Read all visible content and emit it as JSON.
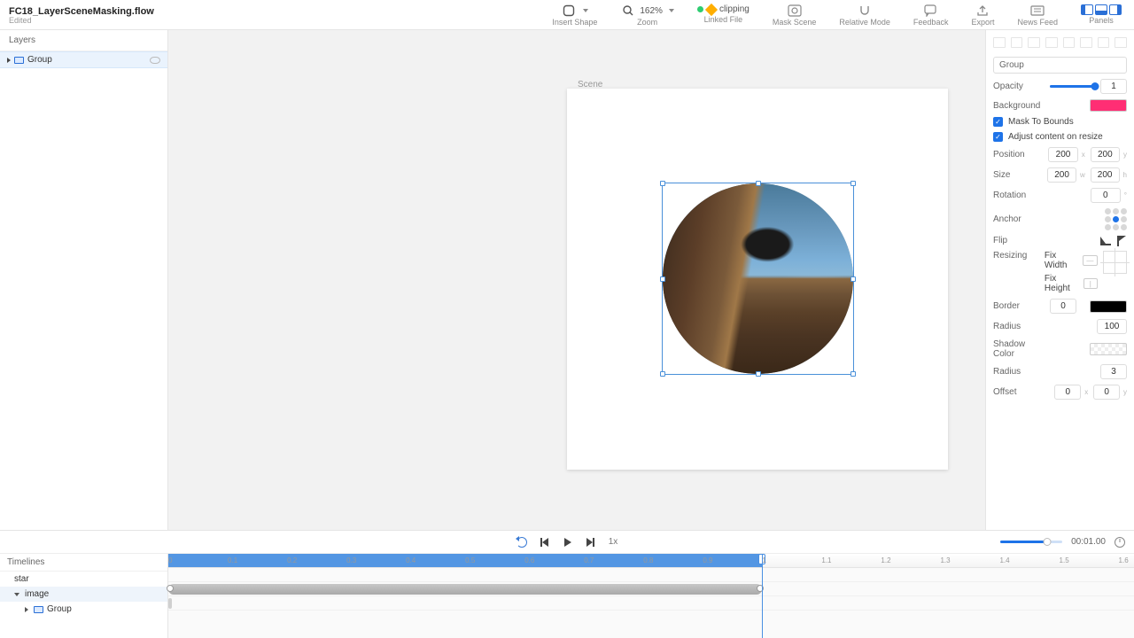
{
  "titlebar": {
    "filename": "FC18_LayerSceneMasking.flow",
    "status": "Edited",
    "insert_shape": "Insert Shape",
    "zoom_label": "Zoom",
    "zoom_value": "162%",
    "linked_file": "Linked File",
    "linked_name": "clipping",
    "mask_scene": "Mask Scene",
    "relative_mode": "Relative Mode",
    "feedback": "Feedback",
    "export": "Export",
    "news_feed": "News Feed",
    "panels": "Panels"
  },
  "layers": {
    "header": "Layers",
    "item0": "Group"
  },
  "canvas": {
    "scene_label": "Scene"
  },
  "inspector": {
    "name": "Group",
    "opacity_label": "Opacity",
    "opacity_value": "1",
    "background_label": "Background",
    "mask_to_bounds": "Mask To Bounds",
    "adjust_content": "Adjust content on resize",
    "position_label": "Position",
    "position_x": "200",
    "position_y": "200",
    "size_label": "Size",
    "size_w": "200",
    "size_h": "200",
    "rotation_label": "Rotation",
    "rotation": "0",
    "anchor_label": "Anchor",
    "flip_label": "Flip",
    "resizing_label": "Resizing",
    "fix_width": "Fix Width",
    "fix_height": "Fix Height",
    "border_label": "Border",
    "border": "0",
    "radius_label": "Radius",
    "radius": "100",
    "shadow_color_label": "Shadow Color",
    "shadow_radius_label": "Radius",
    "shadow_radius": "3",
    "offset_label": "Offset",
    "offset_x": "0",
    "offset_y": "0",
    "background_color": "#ff2e74",
    "border_color": "#000000"
  },
  "playbar": {
    "speed": "1x",
    "timecode": "00:01.00"
  },
  "timeline": {
    "header": "Timelines",
    "row_star": "star",
    "row_image": "image",
    "row_group": "Group",
    "ticks": [
      "0",
      "0.1",
      "0.2",
      "0.3",
      "0.4",
      "0.5",
      "0.6",
      "0.7",
      "0.8",
      "0.9",
      "1",
      "1.1",
      "1.2",
      "1.3",
      "1.4",
      "1.5",
      "1.6"
    ]
  }
}
